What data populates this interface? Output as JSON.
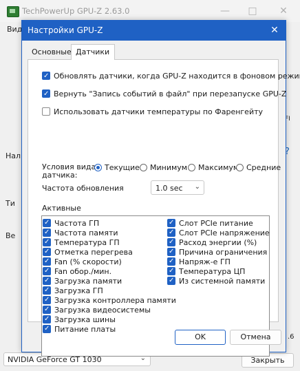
{
  "main_window": {
    "title": "TechPowerUp GPU-Z 2.63.0",
    "minimize_icon": "minimize-icon",
    "maximize_icon": "maximize-icon",
    "close_icon": "close-icon",
    "tab_fragment": "Вид",
    "label_fragments": [
      "Нал",
      "Ти",
      "Ве"
    ],
    "right_fragment_question": "?",
    "right_fragment_small": "FI",
    "right_fragment_bottom": ".6",
    "gpu_select_value": "NVIDIA GeForce GT 1030",
    "close_button": "Закрыть"
  },
  "dialog": {
    "title": "Настройки GPU-Z",
    "tabs": [
      {
        "label": "Основные",
        "active": false
      },
      {
        "label": "Датчики",
        "active": true
      }
    ],
    "options": [
      {
        "label": "Обновлять датчики, когда GPU-Z находится в фоновом режиме",
        "checked": true
      },
      {
        "label": "Вернуть \"Запись событий в файл\" при перезапуске GPU-Z",
        "checked": true
      },
      {
        "label": "Использовать датчики температуры по Фаренгейту",
        "checked": false
      }
    ],
    "view_mode_label": "Условия вида датчика:",
    "view_modes": [
      {
        "label": "Текущие",
        "selected": true
      },
      {
        "label": "Минимум",
        "selected": false
      },
      {
        "label": "Максимум",
        "selected": false
      },
      {
        "label": "Средние",
        "selected": false
      }
    ],
    "refresh_label": "Частота обновления",
    "refresh_value": "1.0 sec",
    "active_label": "Активные",
    "sensors_left": [
      "Частота ГП",
      "Частота памяти",
      "Температура ГП",
      "Отметка перегрева",
      "Fan (% скорости)",
      "Fan обор./мин.",
      "Загрузка памяти",
      "Загрузка ГП",
      "Загрузка контроллера памяти",
      "Загрузка видеосистемы",
      "Загрузка шины",
      "Питание платы"
    ],
    "sensors_right": [
      "Слот PCIe питание",
      "Слот PCIe напряжение",
      "Расход энергии (%)",
      "Причина ограничения",
      "Напряж-е ГП",
      "Температура ЦП",
      "Из системной памяти"
    ],
    "ok_button": "OK",
    "cancel_button": "Отмена",
    "accent_color": "#1f61c4"
  }
}
